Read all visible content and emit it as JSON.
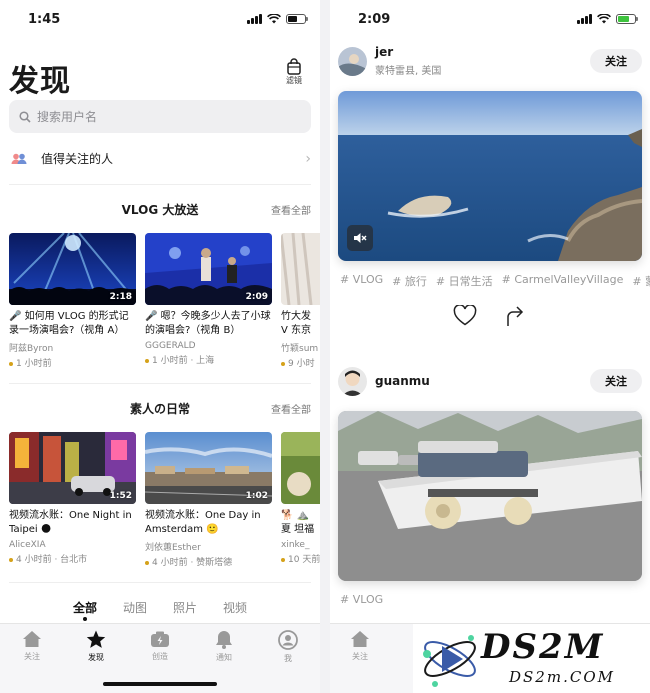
{
  "left": {
    "status_time": "1:45",
    "title": "发现",
    "filter_label": "滤镜",
    "search_placeholder": "搜索用户名",
    "follow_people": "值得关注的人",
    "sections": [
      {
        "title": "VLOG 大放送",
        "see_all": "查看全部",
        "cards": [
          {
            "title": "🎤 如何用 VLOG 的形式记录一场演唱会?（视角 A）",
            "author": "阿兹Byron",
            "meta": "1 小时前",
            "duration": "2:18"
          },
          {
            "title": "🎤 嗯？今晚多少人去了小球的演唱会?（视角 B）",
            "author": "GGGERALD",
            "meta": "1 小时前 · 上海",
            "duration": "2:09"
          },
          {
            "title": "竹大发 V 东京大学",
            "author": "竹颖sum",
            "meta": "9 小时"
          }
        ]
      },
      {
        "title": "素人の日常",
        "see_all": "查看全部",
        "cards": [
          {
            "title": "视频流水账：One Night in Taipei 🌑",
            "author": "AliceXIA",
            "meta": "4 小时前 · 台北市",
            "duration": "1:52"
          },
          {
            "title": "视频流水账：One Day in Amsterdam 🙂",
            "author": "刘依蕙Esther",
            "meta": "4 小时前 · 赞斯塔德",
            "duration": "1:02"
          },
          {
            "title": "🐕 ⛰️ 夏 坦福学姐",
            "author": "xinke_",
            "meta": "10 天前"
          }
        ]
      }
    ],
    "tabs": [
      "全部",
      "动图",
      "照片",
      "视频"
    ],
    "tabbar": [
      "关注",
      "发现",
      "创造",
      "通知",
      "我"
    ]
  },
  "right": {
    "status_time": "2:09",
    "posts": [
      {
        "user": "jer",
        "location": "蒙特雷县, 美国",
        "follow": "关注",
        "tags": [
          "# VLOG",
          "# 旅行",
          "# 日常生活",
          "# CarmelValleyVillage",
          "# 蒙"
        ]
      },
      {
        "user": "guanmu",
        "follow": "关注",
        "tags": [
          "# VLOG"
        ]
      }
    ],
    "tabbar_first": "关注",
    "watermark": {
      "brand": "DS2M",
      "site": "DS2m.COM"
    }
  },
  "colors": {
    "accent_dot": "#d5a21a",
    "battery_green": "#3ec33e"
  }
}
